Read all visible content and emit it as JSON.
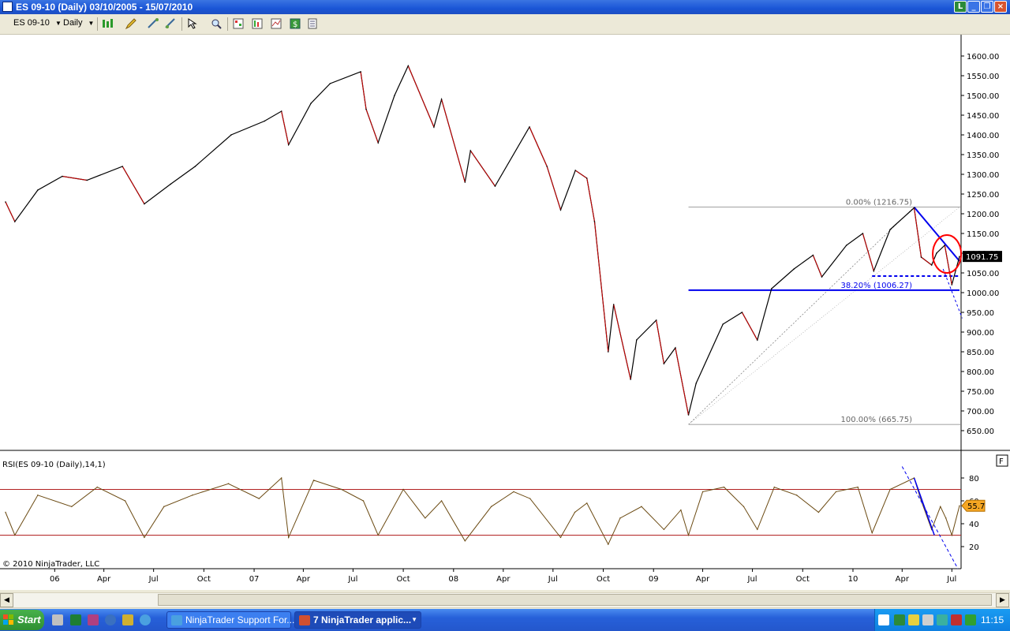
{
  "window": {
    "title": "ES 09-10 (Daily)  03/10/2005 - 15/07/2010"
  },
  "toolbar": {
    "instrument": "ES 09-10",
    "interval": "Daily"
  },
  "chart_data": [
    {
      "type": "line",
      "title": "",
      "ylim": [
        630,
        1640
      ],
      "y_ticks": [
        1600,
        1550,
        1500,
        1450,
        1400,
        1350,
        1300,
        1250,
        1200,
        1150,
        1100,
        1050,
        1000,
        950,
        900,
        850,
        800,
        750,
        700,
        650
      ],
      "y_tick_labels": [
        "1600.00",
        "1550.00",
        "1500.00",
        "1450.00",
        "1400.00",
        "1350.00",
        "1300.00",
        "1250.00",
        "1200.00",
        "1150.00",
        "1100.00",
        "1050.00",
        "1000.00",
        "950.00",
        "900.00",
        "850.00",
        "800.00",
        "750.00",
        "700.00",
        "650.00"
      ],
      "x_tick_labels": [
        "06",
        "Apr",
        "Jul",
        "Oct",
        "07",
        "Apr",
        "Jul",
        "Oct",
        "08",
        "Apr",
        "Jul",
        "Oct",
        "09",
        "Apr",
        "Jul",
        "Oct",
        "10",
        "Apr",
        "Jul"
      ],
      "x_ticks": [
        "2006-01",
        "2006-04",
        "2006-07",
        "2006-10",
        "2007-01",
        "2007-04",
        "2007-07",
        "2007-10",
        "2008-01",
        "2008-04",
        "2008-07",
        "2008-10",
        "2009-01",
        "2009-04",
        "2009-07",
        "2009-10",
        "2010-01",
        "2010-04",
        "2010-07"
      ],
      "x_range": [
        "2005-10-03",
        "2010-07-15"
      ],
      "series": [
        {
          "x": [
            "2005-10-03",
            "2005-10-20",
            "2005-12-01",
            "2006-01-15",
            "2006-03-01",
            "2006-05-05",
            "2006-06-14",
            "2006-08-01",
            "2006-09-15",
            "2006-11-20",
            "2007-01-20",
            "2007-02-20",
            "2007-03-05",
            "2007-04-15",
            "2007-05-20",
            "2007-07-15",
            "2007-07-25",
            "2007-08-16",
            "2007-09-15",
            "2007-10-10",
            "2007-11-26",
            "2007-12-10",
            "2008-01-22",
            "2008-02-01",
            "2008-03-17",
            "2008-05-19",
            "2008-06-20",
            "2008-07-15",
            "2008-08-11",
            "2008-09-01",
            "2008-09-15",
            "2008-10-10",
            "2008-10-20",
            "2008-11-20",
            "2008-12-01",
            "2009-01-06",
            "2009-01-20",
            "2009-02-10",
            "2009-03-06",
            "2009-03-20",
            "2009-05-08",
            "2009-06-12",
            "2009-07-10",
            "2009-08-05",
            "2009-09-15",
            "2009-10-20",
            "2009-11-05",
            "2009-12-20",
            "2010-01-19",
            "2010-02-08",
            "2010-03-10",
            "2010-04-23",
            "2010-05-06",
            "2010-05-25",
            "2010-06-03",
            "2010-06-18",
            "2010-07-01",
            "2010-07-15"
          ],
          "values": [
            1230,
            1180,
            1260,
            1295,
            1285,
            1320,
            1225,
            1275,
            1320,
            1400,
            1435,
            1460,
            1375,
            1480,
            1530,
            1560,
            1465,
            1380,
            1500,
            1575,
            1420,
            1490,
            1280,
            1360,
            1270,
            1420,
            1320,
            1210,
            1310,
            1290,
            1180,
            850,
            970,
            780,
            880,
            930,
            820,
            860,
            690,
            770,
            920,
            950,
            880,
            1010,
            1060,
            1095,
            1040,
            1120,
            1150,
            1055,
            1160,
            1215,
            1090,
            1070,
            1100,
            1120,
            1020,
            1091.75
          ]
        }
      ],
      "last_price_label": "1091.75",
      "fibonacci": {
        "levels": [
          {
            "label": "0.00% (1216.75)",
            "value": 1216.75
          },
          {
            "label": "38.20% (1006.27)",
            "value": 1006.27
          },
          {
            "label": "100.00% (665.75)",
            "value": 665.75
          }
        ]
      },
      "lines": [
        {
          "kind": "thin-trendline",
          "from": {
            "x": "2009-03-06",
            "y": 665.75
          },
          "to": {
            "x": "2010-04-23",
            "y": 1216.75
          }
        },
        {
          "kind": "fib-range",
          "from": {
            "x": "2009-03-06",
            "y": 665.75
          },
          "to": {
            "x": "2010-07-15",
            "y": 1216.75
          }
        },
        {
          "kind": "blue-horizontal",
          "from": {
            "x": "2009-03-06",
            "y": 1006.27
          },
          "to": {
            "x": "2010-07-15",
            "y": 1006.27
          }
        },
        {
          "kind": "blue-dashed-horizontal",
          "from": {
            "x": "2010-02-05",
            "y": 1042
          },
          "to": {
            "x": "2010-07-15",
            "y": 1042
          }
        },
        {
          "kind": "blue-downtrend",
          "from": {
            "x": "2010-04-23",
            "y": 1216.75
          },
          "to": {
            "x": "2010-07-15",
            "y": 1080
          }
        },
        {
          "kind": "blue-dashed-down",
          "from": {
            "x": "2010-06-15",
            "y": 1060
          },
          "to": {
            "x": "2010-07-20",
            "y": 935
          }
        }
      ],
      "ellipse": {
        "center": {
          "x": "2010-06-22",
          "y": 1098
        },
        "note": "red circle highlight"
      }
    },
    {
      "type": "line",
      "title": "RSI(ES 09-10 (Daily),14,1)",
      "ylim": [
        0,
        95
      ],
      "y_ticks": [
        80,
        60,
        40,
        20
      ],
      "y_tick_labels": [
        "80",
        "60",
        "40",
        "20"
      ],
      "reference_lines": [
        70,
        30
      ],
      "series": [
        {
          "x": [
            "2005-10-03",
            "2005-10-20",
            "2005-12-01",
            "2006-02-01",
            "2006-03-20",
            "2006-05-10",
            "2006-06-14",
            "2006-07-20",
            "2006-09-10",
            "2006-11-15",
            "2007-01-10",
            "2007-02-20",
            "2007-03-05",
            "2007-04-20",
            "2007-06-10",
            "2007-07-20",
            "2007-08-16",
            "2007-10-01",
            "2007-11-10",
            "2007-12-10",
            "2008-01-22",
            "2008-03-10",
            "2008-04-20",
            "2008-05-20",
            "2008-07-15",
            "2008-08-10",
            "2008-09-01",
            "2008-10-10",
            "2008-11-01",
            "2008-12-10",
            "2009-01-20",
            "2009-02-20",
            "2009-03-06",
            "2009-04-01",
            "2009-05-10",
            "2009-06-15",
            "2009-07-10",
            "2009-08-10",
            "2009-09-20",
            "2009-10-30",
            "2009-12-01",
            "2010-01-10",
            "2010-02-05",
            "2010-03-10",
            "2010-04-23",
            "2010-05-06",
            "2010-05-25",
            "2010-06-10",
            "2010-06-20",
            "2010-07-01",
            "2010-07-15"
          ],
          "values": [
            50,
            30,
            65,
            55,
            72,
            60,
            28,
            55,
            65,
            75,
            62,
            80,
            28,
            78,
            70,
            60,
            30,
            70,
            45,
            60,
            25,
            55,
            68,
            62,
            28,
            50,
            58,
            22,
            45,
            55,
            35,
            52,
            30,
            68,
            72,
            55,
            35,
            72,
            65,
            50,
            68,
            72,
            32,
            70,
            80,
            60,
            35,
            55,
            45,
            30,
            55.7
          ]
        }
      ],
      "last_value_label": "55.7",
      "trendlines": [
        {
          "kind": "blue-dashed",
          "from": {
            "x": "2010-04-01",
            "y": 90
          },
          "to": {
            "x": "2010-07-12",
            "y": 0
          }
        },
        {
          "kind": "blue-solid",
          "from": {
            "x": "2010-04-23",
            "y": 80
          },
          "to": {
            "x": "2010-05-30",
            "y": 30
          }
        }
      ]
    }
  ],
  "copyright": "© 2010 NinjaTrader, LLC",
  "taskbar": {
    "start_label": "Start",
    "tasks": [
      {
        "label": "NinjaTrader Support For..."
      },
      {
        "label": "7 NinjaTrader applic..."
      }
    ],
    "clock": "11:15"
  },
  "colors": {
    "price_up": "#000000",
    "price_down": "#cc0000",
    "fib": "#808080",
    "blue_lines": "#0000ee",
    "rsi_line": "#6b4a12",
    "rsi_ref": "#b22222",
    "ellipse": "#ff0000"
  }
}
